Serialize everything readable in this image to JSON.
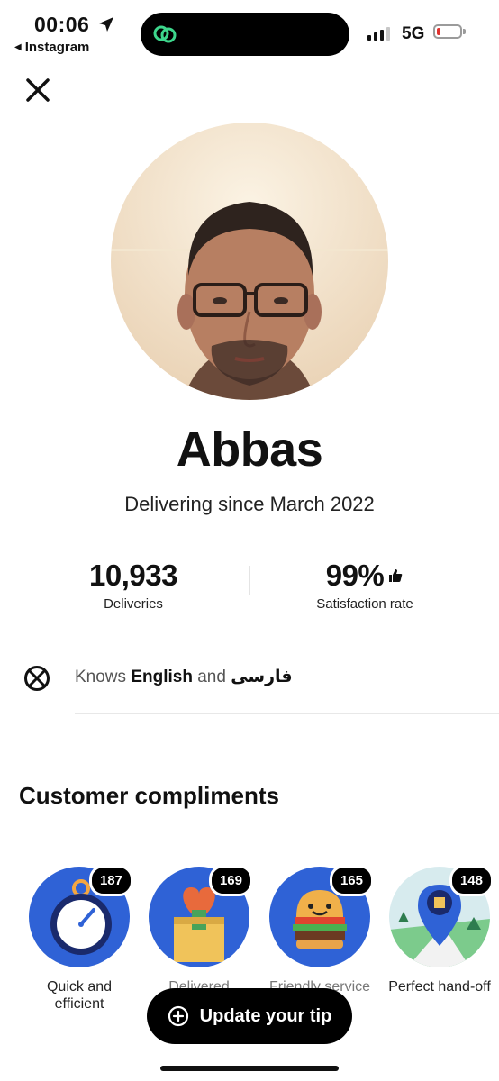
{
  "status_bar": {
    "time": "00:06",
    "back_app": "Instagram",
    "network": "5G",
    "battery_level": 0.15
  },
  "profile": {
    "name": "Abbas",
    "subtitle": "Delivering since March 2022"
  },
  "stats": [
    {
      "value": "10,933",
      "label": "Deliveries"
    },
    {
      "value": "99%",
      "label": "Satisfaction rate"
    }
  ],
  "languages": {
    "prefix": "Knows",
    "lang1": "English",
    "and": "and",
    "lang2": "فارسی"
  },
  "compliments": {
    "title": "Customer compliments",
    "items": [
      {
        "label": "Quick and efficient",
        "count": "187",
        "icon": "stopwatch-icon"
      },
      {
        "label": "Delivered",
        "count": "169",
        "icon": "gift-heart-icon"
      },
      {
        "label": "Friendly service",
        "count": "165",
        "icon": "burger-icon"
      },
      {
        "label": "Perfect hand-off",
        "count": "148",
        "icon": "map-pin-icon"
      }
    ]
  },
  "cta": {
    "label": "Update your tip"
  },
  "colors": {
    "compliment_bg_blue": "#2f62d6",
    "battery_red": "#e0322f",
    "island_green": "#3dd68c"
  }
}
